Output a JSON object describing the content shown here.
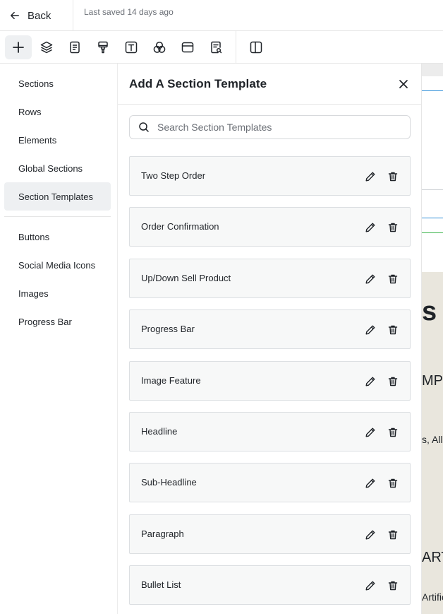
{
  "topbar": {
    "back_label": "Back",
    "saved_status": "Last saved 14 days ago"
  },
  "toolbar": {
    "tools": [
      {
        "name": "add-icon",
        "active": true
      },
      {
        "name": "layers-icon"
      },
      {
        "name": "page-icon"
      },
      {
        "name": "paint-brush-icon"
      },
      {
        "name": "text-icon"
      },
      {
        "name": "color-circles-icon"
      },
      {
        "name": "browser-icon"
      },
      {
        "name": "page-search-icon"
      },
      {
        "name": "split-view-icon"
      }
    ]
  },
  "sidebar": {
    "items": [
      {
        "label": "Sections"
      },
      {
        "label": "Rows"
      },
      {
        "label": "Elements"
      },
      {
        "label": "Global Sections"
      },
      {
        "label": "Section Templates",
        "active": true
      },
      {
        "label": "Buttons"
      },
      {
        "label": "Social Media Icons"
      },
      {
        "label": "Images"
      },
      {
        "label": "Progress Bar"
      }
    ]
  },
  "panel": {
    "title": "Add A Section Template",
    "search_placeholder": "Search Section Templates",
    "search_value": "",
    "templates": [
      {
        "label": "Two Step Order"
      },
      {
        "label": "Order Confirmation"
      },
      {
        "label": "Up/Down Sell Product"
      },
      {
        "label": "Progress Bar"
      },
      {
        "label": "Image Feature"
      },
      {
        "label": "Headline"
      },
      {
        "label": "Sub-Headline"
      },
      {
        "label": "Paragraph"
      },
      {
        "label": "Bullet List"
      }
    ]
  },
  "canvas_preview": {
    "texts": [
      "s",
      "MPL",
      "s, All",
      "ART",
      "Artific"
    ]
  },
  "colors": {
    "active_bg": "#eef0f2",
    "template_bg": "#f7f8f8",
    "border": "#dcdfe2",
    "canvas_beige": "#e9e6dd",
    "canvas_blue_line": "#2f8fd8",
    "canvas_green_line": "#3bb54a"
  }
}
